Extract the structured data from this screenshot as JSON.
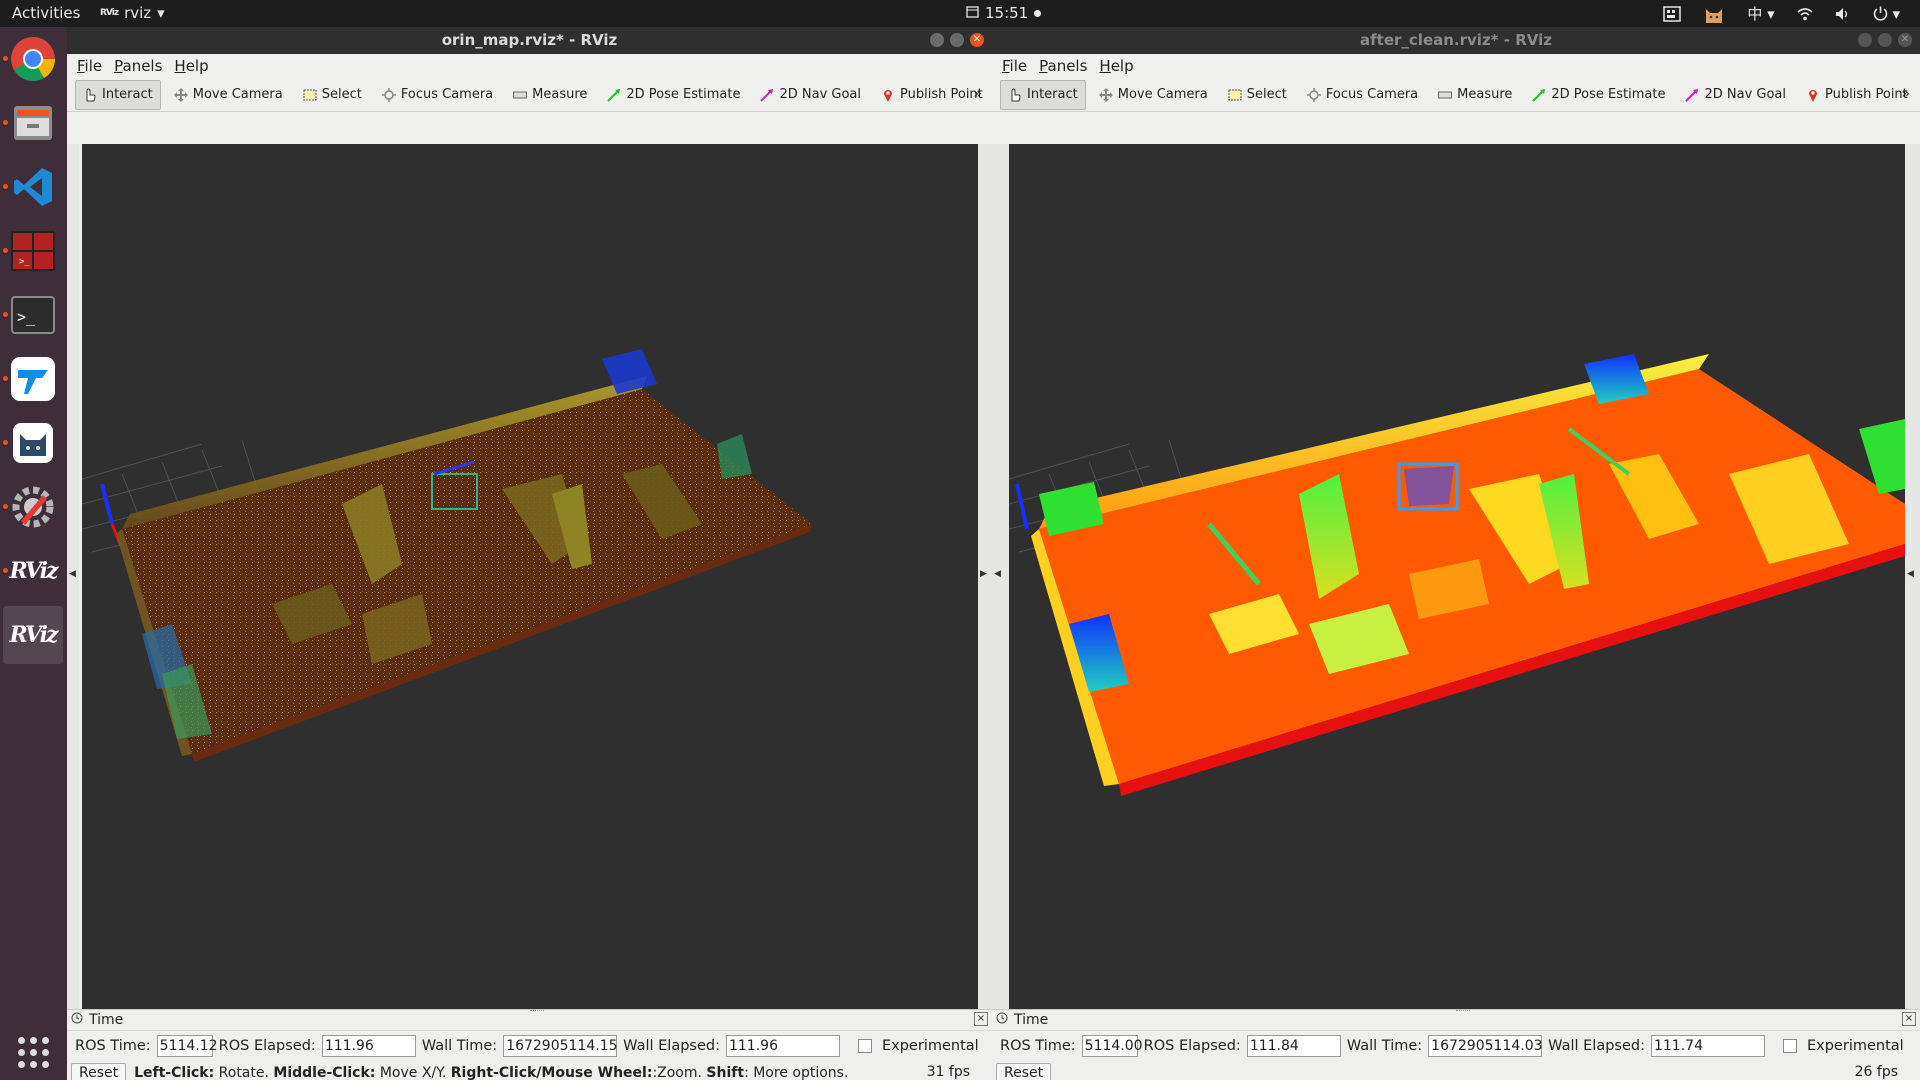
{
  "topbar": {
    "activities": "Activities",
    "app_name": "rviz",
    "app_glyph": "RViz",
    "time": "15:51",
    "tray_input": "中"
  },
  "dock": {
    "items": [
      {
        "name": "chrome-icon"
      },
      {
        "name": "files-icon"
      },
      {
        "name": "vscode-icon"
      },
      {
        "name": "terminator-icon"
      },
      {
        "name": "terminal-icon"
      },
      {
        "name": "teamviewer-icon"
      },
      {
        "name": "clash-icon"
      },
      {
        "name": "software-updater-icon"
      },
      {
        "name": "rviz-icon"
      },
      {
        "name": "rviz-icon"
      }
    ],
    "rviz_label": "RViz"
  },
  "left": {
    "title": "orin_map.rviz* - RViz",
    "menu": [
      "File",
      "Panels",
      "Help"
    ],
    "tools": [
      "Interact",
      "Move Camera",
      "Select",
      "Focus Camera",
      "Measure",
      "2D Pose Estimate",
      "2D Nav Goal",
      "Publish Point"
    ],
    "time_title": "Time",
    "ros_time_label": "ROS Time:",
    "ros_time": "5114.12",
    "ros_elapsed_label": "ROS Elapsed:",
    "ros_elapsed": "111.96",
    "wall_time_label": "Wall Time:",
    "wall_time": "1672905114.15",
    "wall_elapsed_label": "Wall Elapsed:",
    "wall_elapsed": "111.96",
    "experimental": "Experimental",
    "reset": "Reset",
    "hint_left_click": "Left-Click:",
    "hint_rotate": "Rotate.",
    "hint_middle_click": "Middle-Click:",
    "hint_move": "Move X/Y.",
    "hint_right_click": "Right-Click/Mouse Wheel:",
    "hint_zoom": ":Zoom.",
    "hint_shift": "Shift",
    "hint_more": ": More options.",
    "fps": "31 fps"
  },
  "right": {
    "title": "after_clean.rviz* - RViz",
    "menu": [
      "File",
      "Panels",
      "Help"
    ],
    "tools": [
      "Interact",
      "Move Camera",
      "Select",
      "Focus Camera",
      "Measure",
      "2D Pose Estimate",
      "2D Nav Goal",
      "Publish Point"
    ],
    "time_title": "Time",
    "ros_time_label": "ROS Time:",
    "ros_time": "5114.00",
    "ros_elapsed_label": "ROS Elapsed:",
    "ros_elapsed": "111.84",
    "wall_time_label": "Wall Time:",
    "wall_time": "1672905114.03",
    "wall_elapsed_label": "Wall Elapsed:",
    "wall_elapsed": "111.74",
    "experimental": "Experimental",
    "reset": "Reset",
    "fps": "26 fps"
  },
  "colors": {
    "topbar": "#1d1d1d",
    "dock": "#3d2e3a",
    "viewport": "#2f2f2f",
    "accent_close": "#e9541f",
    "sparse_map_floor": "#7a3a18",
    "dense_map_floor": "#ff5a00",
    "wall_yellow": "#e8e020",
    "wall_green": "#30e030",
    "wall_blue": "#1040ff"
  }
}
